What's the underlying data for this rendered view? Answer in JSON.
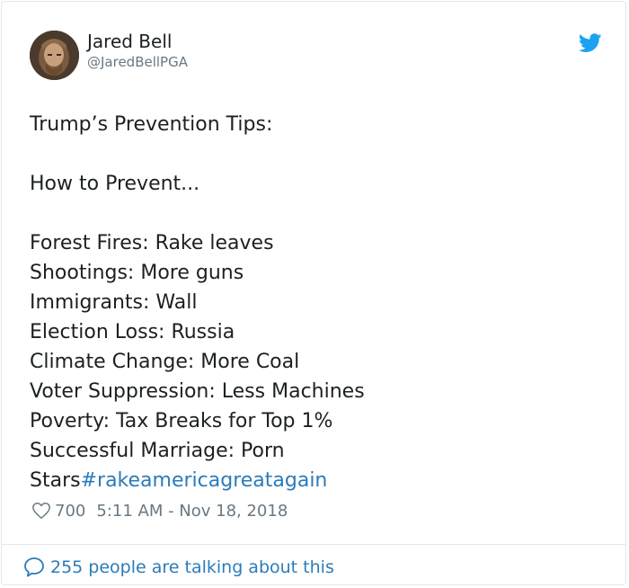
{
  "author": {
    "name": "Jared Bell",
    "handle": "@JaredBellPGA"
  },
  "tweet": {
    "heading": "Trump’s Prevention Tips:",
    "subheading": "How to Prevent...",
    "items": [
      "Forest Fires: Rake leaves",
      "Shootings: More guns",
      "Immigrants: Wall",
      "Election Loss: Russia",
      "Climate Change: More Coal",
      "Voter Suppression: Less Machines",
      "Poverty: Tax Breaks for Top 1%",
      "Successful Marriage: Porn"
    ],
    "last_line_text": "Stars",
    "hashtag": "#rakeamericagreatagain"
  },
  "meta": {
    "likes": "700",
    "timestamp": "5:11 AM - Nov 18, 2018"
  },
  "footer": {
    "talking": "255 people are talking about this"
  },
  "icons": {
    "brand": "twitter-bird-icon",
    "like": "heart-icon",
    "reply": "speech-bubble-icon"
  },
  "colors": {
    "link": "#2b7bb9",
    "brand": "#1da1f2",
    "muted": "#697882",
    "text": "#1c2022"
  }
}
